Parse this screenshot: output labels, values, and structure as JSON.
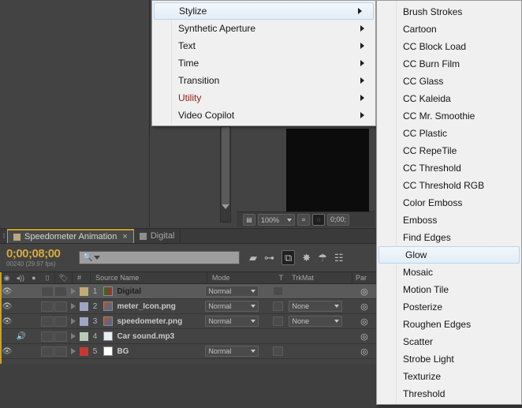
{
  "app": {
    "background_color": "#434343",
    "accent_color": "#c9a227"
  },
  "viewer": {
    "toolbar": {
      "region_of_interest_icon": "roi-icon",
      "zoom_value": "100%",
      "zoom_dropdown_icon": "chevron-down-icon",
      "resolution_icon": "fit-icon",
      "mask_icon": "mask-icon",
      "current_time": "0;00;"
    }
  },
  "timeline": {
    "tabs": [
      {
        "label": "Speedometer Animation",
        "active": true,
        "closable": true,
        "swatch": "tan"
      },
      {
        "label": "Digital",
        "active": false,
        "closable": false,
        "swatch": "grey"
      }
    ],
    "timecode": {
      "current": "0;00;08;00",
      "frames": "00240 (29.97 fps)"
    },
    "search": {
      "placeholder": "",
      "value": "",
      "icon": "search-icon"
    },
    "tools": [
      {
        "name": "composition-mini-flowchart-icon",
        "glyph": "▰"
      },
      {
        "name": "graph-editor-icon",
        "glyph": "⊸"
      },
      {
        "name": "draft-3d-icon",
        "glyph": "⧉",
        "active": true
      },
      {
        "name": "motion-blur-icon",
        "glyph": "✸"
      },
      {
        "name": "brainstorm-icon",
        "glyph": "☂"
      },
      {
        "name": "comp-flowchart-icon",
        "glyph": "☷"
      }
    ],
    "columns": [
      "◉",
      "◆",
      "●",
      "⚿",
      "",
      "#",
      "Source Name",
      "Mode",
      "T",
      "TrkMat",
      "Par"
    ],
    "column_labels": {
      "hash": "#",
      "source_name": "Source Name",
      "mode": "Mode",
      "t": "T",
      "trkmat": "TrkMat",
      "parent": "Par"
    },
    "layers": [
      {
        "index": "1",
        "name": "Digital",
        "visible": true,
        "audio": false,
        "color": "#c3aa78",
        "thumb": "composition-icon",
        "mode": "Normal",
        "has_t": true,
        "trkmat": null,
        "selected": true
      },
      {
        "index": "2",
        "name": "meter_Icon.png",
        "visible": true,
        "audio": false,
        "color": "#9fa5c4",
        "thumb": "image-icon",
        "mode": "Normal",
        "has_t": true,
        "trkmat": "None",
        "selected": false
      },
      {
        "index": "3",
        "name": "speedometer.png",
        "visible": true,
        "audio": false,
        "color": "#9fa5c4",
        "thumb": "image-icon",
        "mode": "Normal",
        "has_t": true,
        "trkmat": "None",
        "selected": false
      },
      {
        "index": "4",
        "name": "Car sound.mp3",
        "visible": false,
        "audio": true,
        "color": "#b7cbb7",
        "thumb": "audio-icon",
        "mode": null,
        "has_t": false,
        "trkmat": null,
        "selected": false
      },
      {
        "index": "5",
        "name": "BG",
        "visible": true,
        "audio": false,
        "color": "#c43a33",
        "thumb": "solid-icon",
        "mode": "Normal",
        "has_t": true,
        "trkmat": null,
        "selected": false
      }
    ]
  },
  "menu_effect_categories": {
    "items": [
      {
        "label": "Stylize",
        "highlighted": true,
        "submenu": true,
        "red": false
      },
      {
        "label": "Synthetic Aperture",
        "highlighted": false,
        "submenu": true,
        "red": false
      },
      {
        "label": "Text",
        "highlighted": false,
        "submenu": true,
        "red": false
      },
      {
        "label": "Time",
        "highlighted": false,
        "submenu": true,
        "red": false
      },
      {
        "label": "Transition",
        "highlighted": false,
        "submenu": true,
        "red": false
      },
      {
        "label": "Utility",
        "highlighted": false,
        "submenu": true,
        "red": true
      },
      {
        "label": "Video Copilot",
        "highlighted": false,
        "submenu": true,
        "red": false
      }
    ]
  },
  "menu_stylize_effects": {
    "items": [
      {
        "label": "Brush Strokes",
        "highlighted": false
      },
      {
        "label": "Cartoon",
        "highlighted": false
      },
      {
        "label": "CC Block Load",
        "highlighted": false
      },
      {
        "label": "CC Burn Film",
        "highlighted": false
      },
      {
        "label": "CC Glass",
        "highlighted": false
      },
      {
        "label": "CC Kaleida",
        "highlighted": false
      },
      {
        "label": "CC Mr. Smoothie",
        "highlighted": false
      },
      {
        "label": "CC Plastic",
        "highlighted": false
      },
      {
        "label": "CC RepeTile",
        "highlighted": false
      },
      {
        "label": "CC Threshold",
        "highlighted": false
      },
      {
        "label": "CC Threshold RGB",
        "highlighted": false
      },
      {
        "label": "Color Emboss",
        "highlighted": false
      },
      {
        "label": "Emboss",
        "highlighted": false
      },
      {
        "label": "Find Edges",
        "highlighted": false
      },
      {
        "label": "Glow",
        "highlighted": true
      },
      {
        "label": "Mosaic",
        "highlighted": false
      },
      {
        "label": "Motion Tile",
        "highlighted": false
      },
      {
        "label": "Posterize",
        "highlighted": false
      },
      {
        "label": "Roughen Edges",
        "highlighted": false
      },
      {
        "label": "Scatter",
        "highlighted": false
      },
      {
        "label": "Strobe Light",
        "highlighted": false
      },
      {
        "label": "Texturize",
        "highlighted": false
      },
      {
        "label": "Threshold",
        "highlighted": false
      }
    ]
  }
}
